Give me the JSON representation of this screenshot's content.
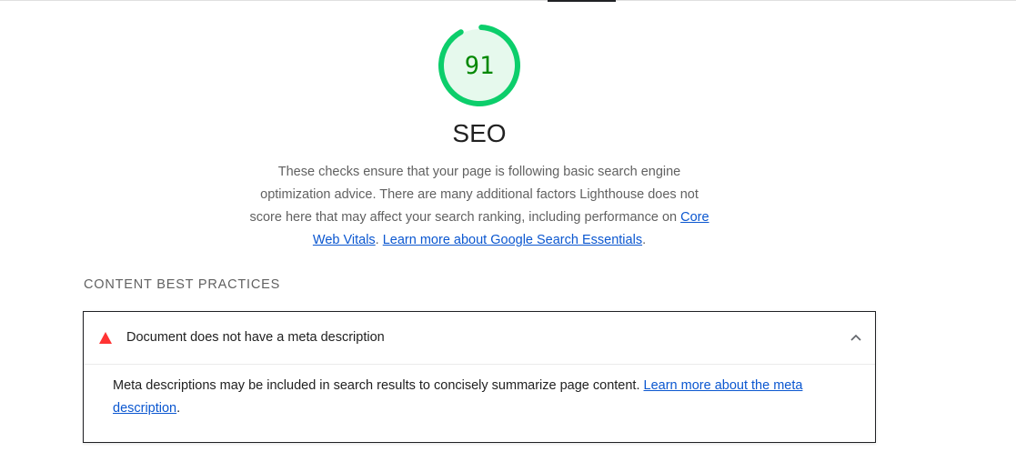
{
  "score": {
    "value": "91",
    "percent": 0.91,
    "color": "#0cce6b",
    "text_color": "#008800",
    "bg_color": "#e6f9ed"
  },
  "category": {
    "title": "SEO",
    "description_text": "These checks ensure that your page is following basic search engine optimization advice. There are many additional factors Lighthouse does not score here that may affect your search ranking, including performance on ",
    "link1": "Core Web Vitals",
    "separator": ". ",
    "link2": "Learn more about Google Search Essentials",
    "end": "."
  },
  "group": {
    "title": "CONTENT BEST PRACTICES"
  },
  "audit": {
    "status_icon": "fail-triangle-icon",
    "fail_color": "#ff3333",
    "title": "Document does not have a meta description",
    "description": "Meta descriptions may be included in search results to concisely summarize page content. ",
    "link": "Learn more about the meta description",
    "end": ".",
    "expanded": true
  }
}
